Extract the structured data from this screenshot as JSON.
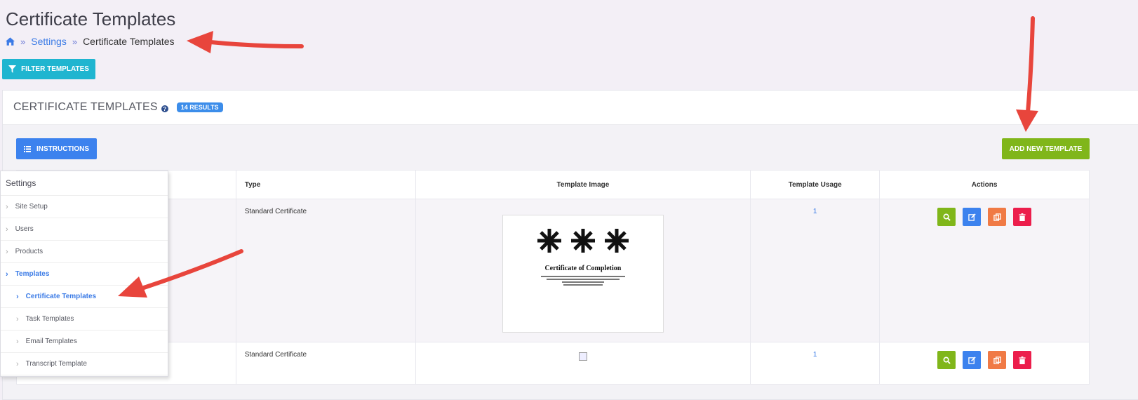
{
  "page": {
    "title": "Certificate Templates"
  },
  "breadcrumb": {
    "home_icon": "home-icon",
    "items": [
      "Settings",
      "Certificate Templates"
    ],
    "separator": "»"
  },
  "toolbar": {
    "filter_label": "FILTER TEMPLATES"
  },
  "panel": {
    "title": "CERTIFICATE TEMPLATES",
    "help": "?",
    "results": "14 RESULTS",
    "instructions_label": "INSTRUCTIONS",
    "add_label": "ADD NEW TEMPLATE"
  },
  "table": {
    "headers": [
      "Type",
      "Template Image",
      "Template Usage",
      "Actions"
    ],
    "rows": [
      {
        "type": "Standard Certificate",
        "usage": "1",
        "image_title": "Certificate of Completion"
      },
      {
        "type": "Standard Certificate",
        "usage": "1"
      }
    ]
  },
  "menu": {
    "header": "Settings",
    "items": [
      "Site Setup",
      "Users",
      "Products",
      "Templates"
    ],
    "sub_items": [
      "Certificate Templates",
      "Task Templates",
      "Email Templates",
      "Transcript Template"
    ]
  },
  "colors": {
    "accent_blue": "#3c82ee",
    "filter_cyan": "#1fb5d0",
    "add_green": "#80b61a",
    "copy_orange": "#f07a45",
    "delete_red": "#ec1e4c",
    "annotation_arrow": "#e8453c"
  }
}
